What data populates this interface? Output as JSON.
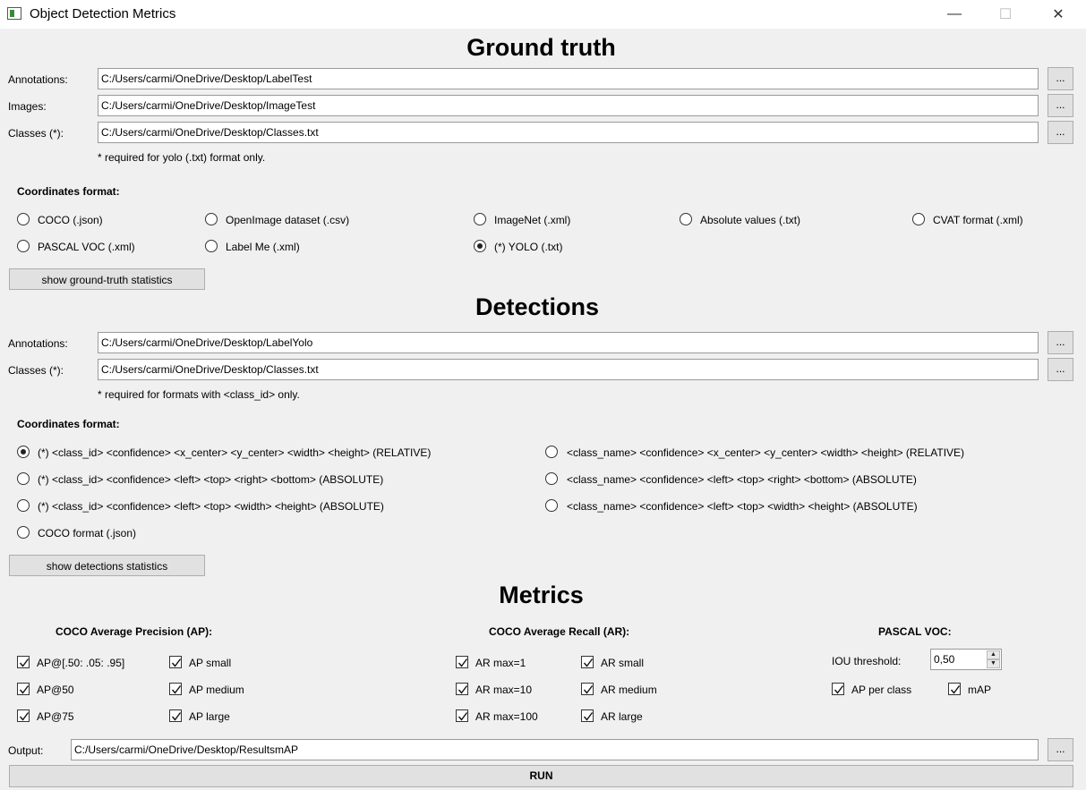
{
  "window": {
    "title": "Object Detection Metrics",
    "minimize": "—",
    "maximize": "☐",
    "close": "✕"
  },
  "ground_truth": {
    "title": "Ground truth",
    "annotations_label": "Annotations:",
    "annotations_path": "C:/Users/carmi/OneDrive/Desktop/LabelTest",
    "images_label": "Images:",
    "images_path": "C:/Users/carmi/OneDrive/Desktop/ImageTest",
    "classes_label": "Classes (*):",
    "classes_path": "C:/Users/carmi/OneDrive/Desktop/Classes.txt",
    "browse": "...",
    "note": "* required for yolo (.txt) format only.",
    "coords_title": "Coordinates format:",
    "formats": [
      {
        "label": "COCO (.json)",
        "selected": false
      },
      {
        "label": "OpenImage dataset (.csv)",
        "selected": false
      },
      {
        "label": "ImageNet (.xml)",
        "selected": false
      },
      {
        "label": "Absolute values (.txt)",
        "selected": false
      },
      {
        "label": "CVAT format (.xml)",
        "selected": false
      },
      {
        "label": "PASCAL VOC (.xml)",
        "selected": false
      },
      {
        "label": "Label Me (.xml)",
        "selected": false
      },
      {
        "label": "(*) YOLO (.txt)",
        "selected": true
      }
    ],
    "stats_button": "show ground-truth statistics"
  },
  "detections": {
    "title": "Detections",
    "annotations_label": "Annotations:",
    "annotations_path": "C:/Users/carmi/OneDrive/Desktop/LabelYolo",
    "classes_label": "Classes (*):",
    "classes_path": "C:/Users/carmi/OneDrive/Desktop/Classes.txt",
    "browse": "...",
    "note": "* required for formats with <class_id> only.",
    "coords_title": "Coordinates format:",
    "formats": [
      {
        "label": "(*) <class_id> <confidence> <x_center> <y_center> <width> <height> (RELATIVE)",
        "selected": true
      },
      {
        "label": "<class_name> <confidence> <x_center> <y_center> <width> <height> (RELATIVE)",
        "selected": false
      },
      {
        "label": "(*) <class_id> <confidence> <left> <top> <right> <bottom> (ABSOLUTE)",
        "selected": false
      },
      {
        "label": "<class_name> <confidence> <left> <top> <right> <bottom> (ABSOLUTE)",
        "selected": false
      },
      {
        "label": "(*) <class_id> <confidence> <left> <top> <width> <height> (ABSOLUTE)",
        "selected": false
      },
      {
        "label": "<class_name> <confidence> <left> <top> <width> <height> (ABSOLUTE)",
        "selected": false
      },
      {
        "label": "COCO format (.json)",
        "selected": false
      }
    ],
    "stats_button": "show detections statistics"
  },
  "metrics": {
    "title": "Metrics",
    "ap_title": "COCO Average Precision (AP):",
    "ar_title": "COCO Average Recall (AR):",
    "voc_title": "PASCAL VOC:",
    "ap": [
      {
        "label": "AP@[.50: .05: .95]",
        "checked": true
      },
      {
        "label": "AP small",
        "checked": true
      },
      {
        "label": "AP@50",
        "checked": true
      },
      {
        "label": "AP medium",
        "checked": true
      },
      {
        "label": "AP@75",
        "checked": true
      },
      {
        "label": "AP large",
        "checked": true
      }
    ],
    "ar": [
      {
        "label": "AR max=1",
        "checked": true
      },
      {
        "label": "AR small",
        "checked": true
      },
      {
        "label": "AR max=10",
        "checked": true
      },
      {
        "label": "AR medium",
        "checked": true
      },
      {
        "label": "AR max=100",
        "checked": true
      },
      {
        "label": "AR large",
        "checked": true
      }
    ],
    "iou_label": "IOU threshold:",
    "iou_value": "0,50",
    "voc": [
      {
        "label": "AP per class",
        "checked": true
      },
      {
        "label": "mAP",
        "checked": true
      }
    ]
  },
  "output": {
    "label": "Output:",
    "path": "C:/Users/carmi/OneDrive/Desktop/ResultsmAP",
    "browse": "..."
  },
  "run_button": "RUN"
}
